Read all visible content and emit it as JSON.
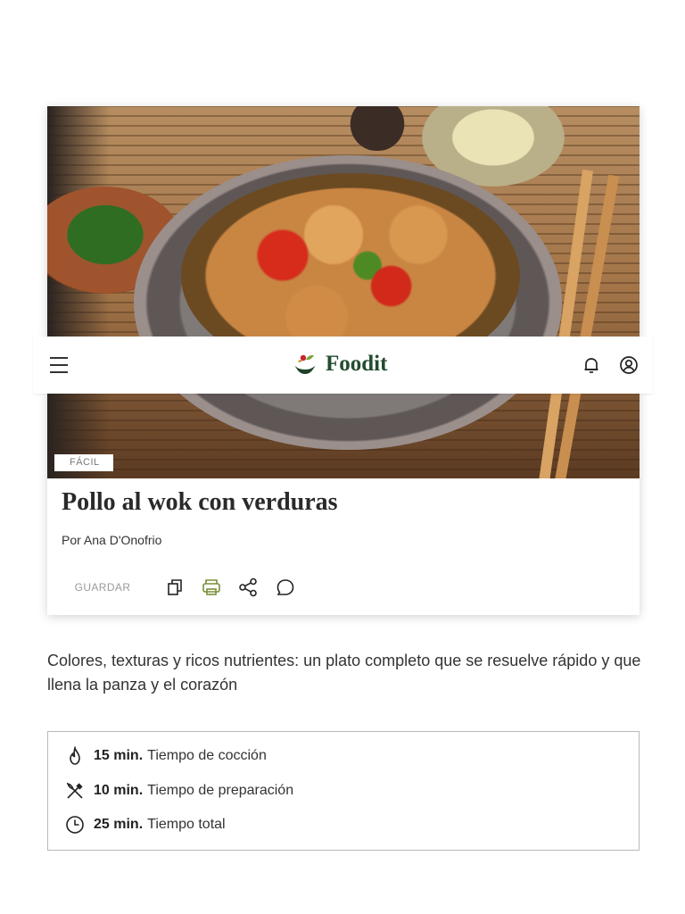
{
  "header": {
    "brand": "Foodit",
    "menu_icon": "hamburger-icon",
    "notifications_icon": "bell-icon",
    "account_icon": "user-icon"
  },
  "recipe": {
    "difficulty_tag": "FÁCIL",
    "title": "Pollo al wok con verduras",
    "author": "Por Ana D'Onofrio",
    "actions": {
      "save_label": "GUARDAR",
      "icons": [
        "copy-icon",
        "print-icon",
        "share-icon",
        "comment-icon"
      ]
    },
    "intro": "Colores, texturas y ricos nutrientes: un plato completo que se resuelve rápido y que llena la panza y el corazón",
    "times": [
      {
        "icon": "flame-icon",
        "value": "15 min.",
        "label": "Tiempo de cocción"
      },
      {
        "icon": "utensils-icon",
        "value": "10 min.",
        "label": "Tiempo de preparación"
      },
      {
        "icon": "clock-icon",
        "value": "25 min.",
        "label": "Tiempo total"
      }
    ]
  },
  "colors": {
    "brand_green": "#234c2e",
    "accent_print": "#7a8f3a",
    "brand_red": "#c8262b"
  }
}
